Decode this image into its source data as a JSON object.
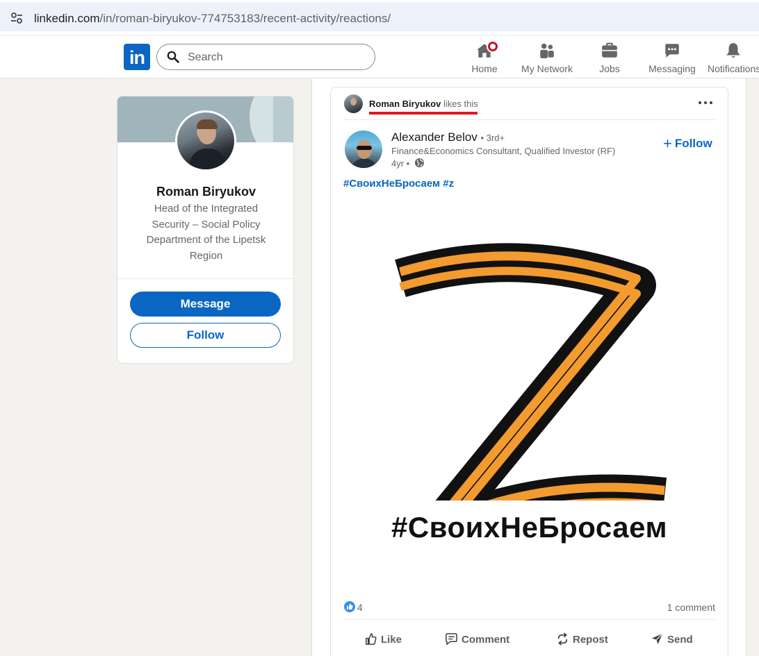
{
  "browser": {
    "url_host": "linkedin.com",
    "url_path": "/in/roman-biryukov-774753183/recent-activity/reactions/"
  },
  "header": {
    "logo_text": "in",
    "search_placeholder": "Search",
    "nav": [
      {
        "label": "Home",
        "icon": "home-icon",
        "has_badge": true
      },
      {
        "label": "My Network",
        "icon": "people-icon"
      },
      {
        "label": "Jobs",
        "icon": "briefcase-icon"
      },
      {
        "label": "Messaging",
        "icon": "chat-icon"
      },
      {
        "label": "Notifications",
        "icon": "bell-icon"
      }
    ]
  },
  "profile": {
    "name": "Roman Biryukov",
    "headline": "Head of the Integrated Security – Social Policy Department of the Lipetsk Region",
    "message_label": "Message",
    "follow_label": "Follow"
  },
  "post": {
    "context_actor": "Roman Biryukov",
    "context_action": "likes this",
    "author_name": "Alexander Belov",
    "author_degree": "• 3rd+",
    "author_title": "Finance&Economics Consultant, Qualified Investor (RF)",
    "age": "4yr •",
    "follow_label": "Follow",
    "hashtags": "#СвоихНеБросаем #z",
    "image_caption": "#СвоихНеБросаем",
    "reaction_count": "4",
    "comments_label": "1 comment",
    "actions": {
      "like": "Like",
      "comment": "Comment",
      "repost": "Repost",
      "send": "Send"
    }
  },
  "colors": {
    "brand": "#0a66c2",
    "badge": "#cb112d",
    "ribbon_orange": "#f39b2e",
    "ribbon_black": "#111111",
    "highlight_underline": "#e0191f"
  }
}
